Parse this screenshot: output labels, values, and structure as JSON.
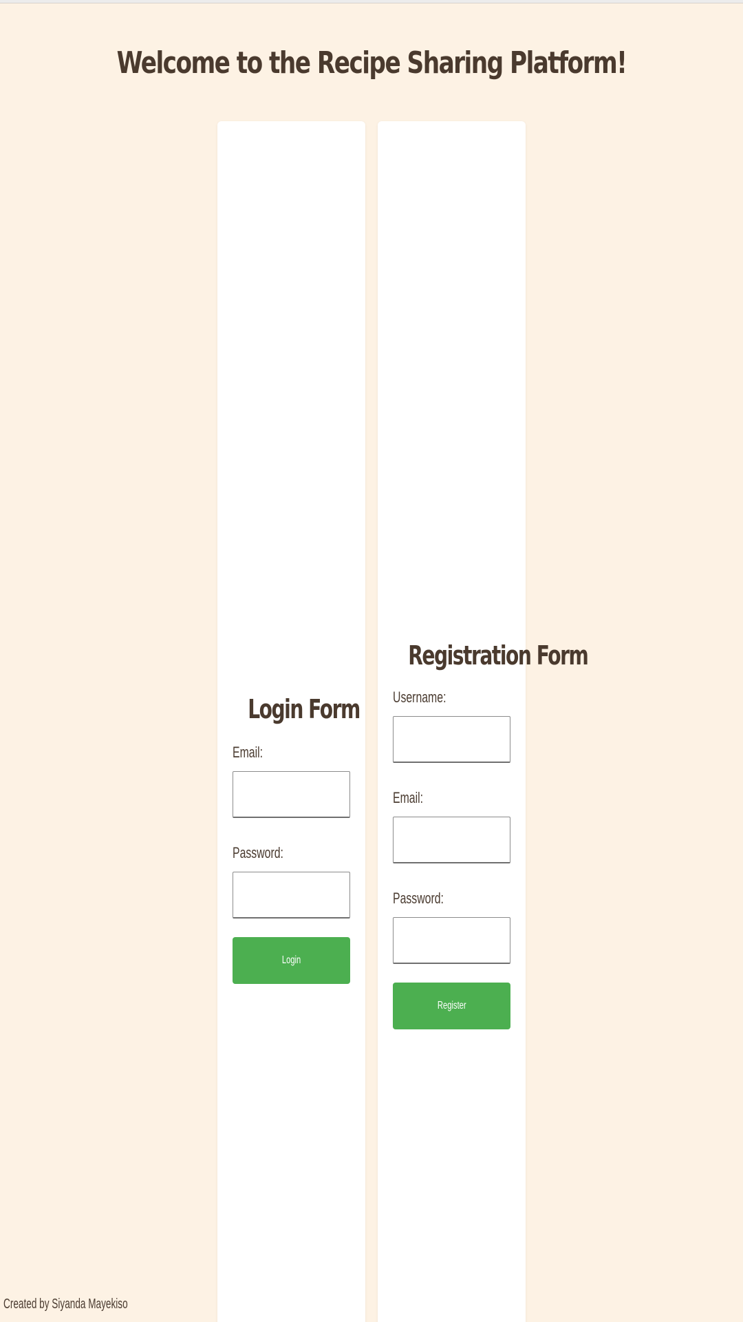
{
  "page": {
    "title": "Welcome to the Recipe Sharing Platform!",
    "footer_credit": "Created by Siyanda Mayekiso"
  },
  "login_form": {
    "title": "Login Form",
    "email_label": "Email:",
    "email_value": "",
    "password_label": "Password:",
    "password_value": "",
    "submit_label": "Login"
  },
  "registration_form": {
    "title": "Registration Form",
    "username_label": "Username:",
    "username_value": "",
    "email_label": "Email:",
    "email_value": "",
    "password_label": "Password:",
    "password_value": "",
    "submit_label": "Register"
  },
  "colors": {
    "background": "#fdf2e4",
    "card": "#ffffff",
    "heading": "#4a3a2e",
    "button": "#4caf50",
    "button_text": "#ffffff"
  }
}
